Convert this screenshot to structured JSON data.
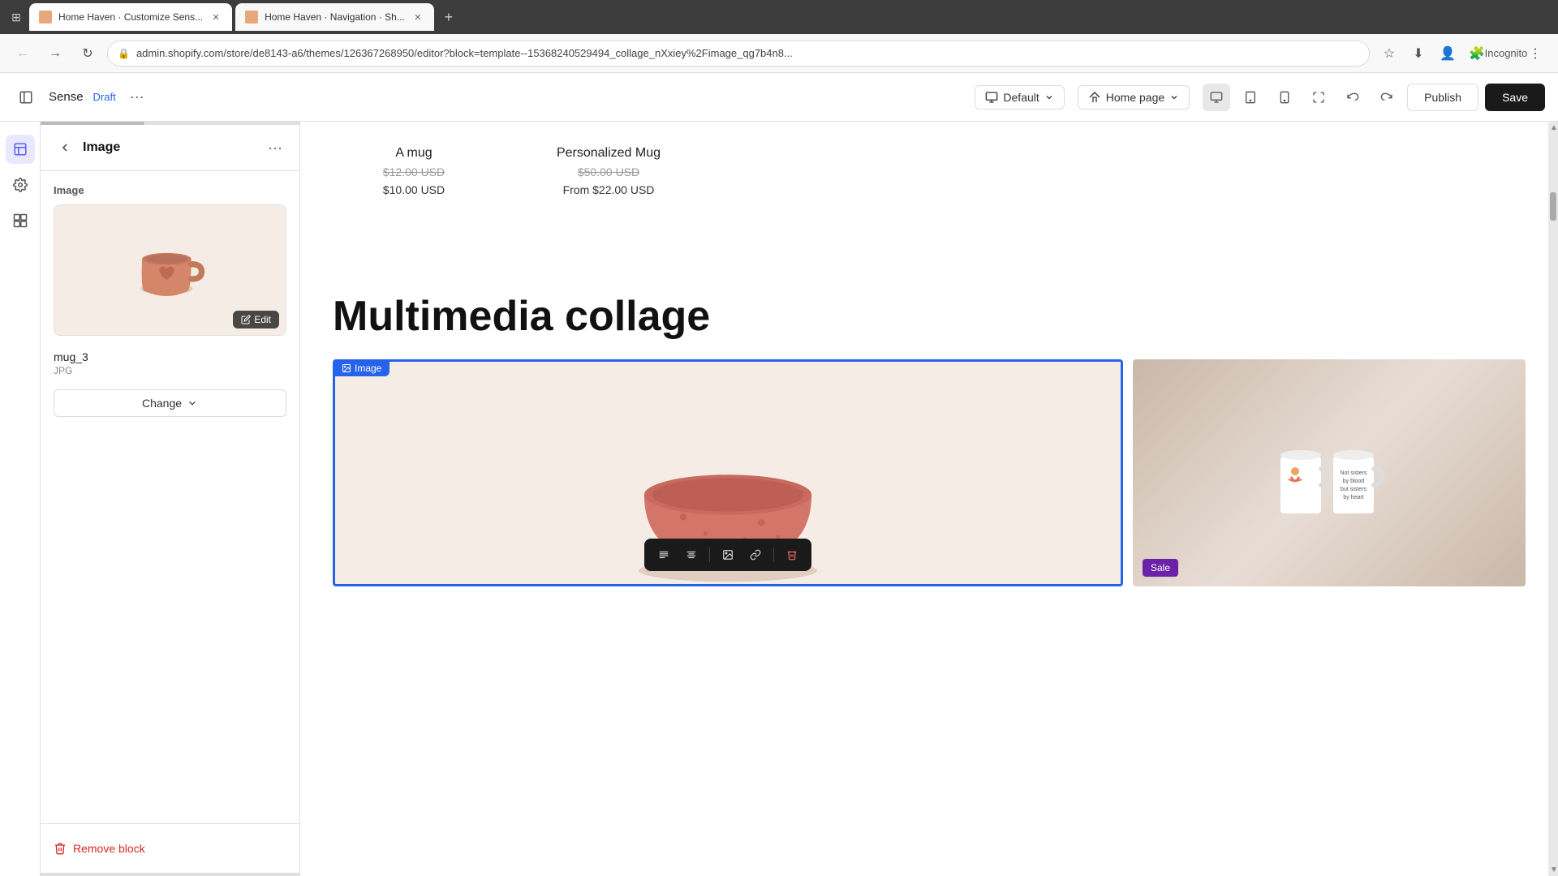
{
  "browser": {
    "tabs": [
      {
        "id": "tab1",
        "title": "Home Haven · Customize Sens...",
        "active": true
      },
      {
        "id": "tab2",
        "title": "Home Haven · Navigation · Sh...",
        "active": false
      }
    ],
    "url": "admin.shopify.com/store/de8143-a6/themes/126367268950/editor?block=template--15368240529494_collage_nXxiey%2Fimage_qg7b4n8...",
    "new_tab_label": "+"
  },
  "header": {
    "store_name": "Sense",
    "draft_label": "Draft",
    "more_label": "···",
    "default_label": "Default",
    "page_label": "Home page",
    "publish_label": "Publish",
    "save_label": "Save"
  },
  "panel": {
    "title": "Image",
    "section_label": "Image",
    "image_name": "mug_3",
    "image_type": "JPG",
    "edit_label": "Edit",
    "change_label": "Change",
    "remove_block_label": "Remove block"
  },
  "preview": {
    "products": [
      {
        "name": "A mug",
        "original_price": "$12.00 USD",
        "sale_price": "$10.00 USD"
      },
      {
        "name": "Personalized Mug",
        "original_price": "$50.00 USD",
        "sale_price": "From $22.00 USD"
      }
    ],
    "collage": {
      "title": "Multimedia collage",
      "image_label": "Image",
      "sale_badge": "Sale"
    }
  },
  "toolbar_items": [
    {
      "icon": "align-left",
      "label": "align-left"
    },
    {
      "icon": "align-center",
      "label": "align-center"
    },
    {
      "icon": "image",
      "label": "image"
    },
    {
      "icon": "link",
      "label": "link"
    },
    {
      "icon": "trash",
      "label": "delete"
    }
  ]
}
